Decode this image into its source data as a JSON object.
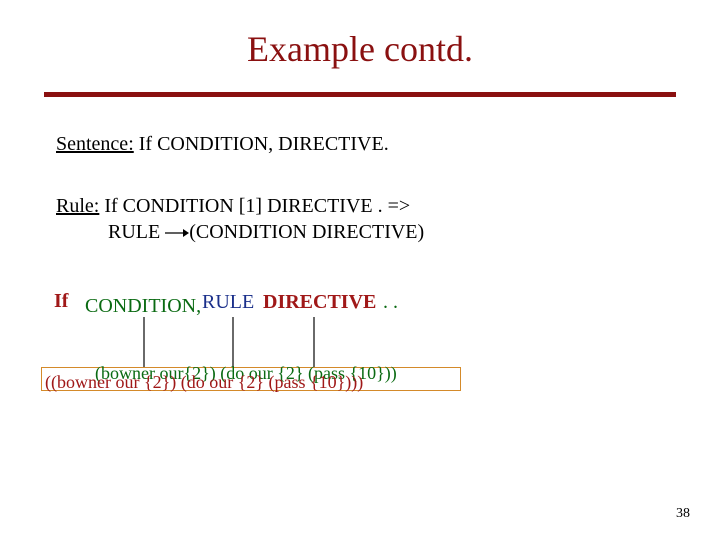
{
  "title": "Example contd.",
  "sentence": {
    "label": "Sentence:",
    "body": " If CONDITION, DIRECTIVE."
  },
  "rule": {
    "label": "Rule:",
    "line1_after": " If CONDITION [1] DIRECTIVE  . =>",
    "line2_before": "RULE   ",
    "line2_after": "(CONDITION DIRECTIVE)"
  },
  "overlay": {
    "if_token": "If",
    "condition_token": "CONDITION,",
    "rule_token": "RULE",
    "directive_token": "DIRECTIVE",
    "dots": ". ."
  },
  "lisp": {
    "green": "(bowner our{2}) (do our {2} (pass {10}))",
    "red": "((bowner our {2}) (do our {2} (pass {10})))"
  },
  "pagenum": "38"
}
